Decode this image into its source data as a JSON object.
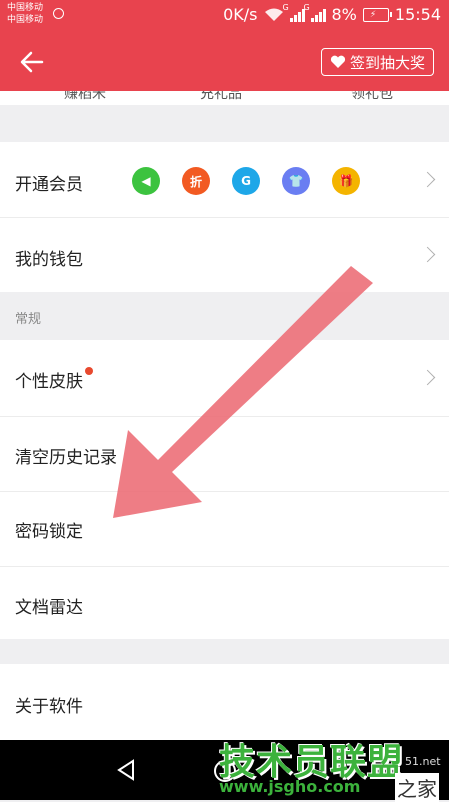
{
  "status_bar": {
    "carrier1": "中国移动",
    "carrier2": "中国移动",
    "speed": "0K/s",
    "network_type": "G",
    "battery": "8%",
    "time": "15:54"
  },
  "app_bar": {
    "signin_label": "签到抽大奖"
  },
  "peek_items": [
    "赚稻米",
    "充礼品",
    "领礼包"
  ],
  "rows": {
    "membership": "开通会员",
    "wallet": "我的钱包",
    "section_general": "常规",
    "skin": "个性皮肤",
    "clear_history": "清空历史记录",
    "password_lock": "密码锁定",
    "doc_radar": "文档雷达",
    "about": "关于软件"
  },
  "vip_icons": [
    {
      "icon": "megaphone-icon",
      "color": "#3cc33f",
      "glyph": "◀"
    },
    {
      "icon": "discount-icon",
      "color": "#f25a22",
      "glyph": "折"
    },
    {
      "icon": "g-icon",
      "color": "#1ea7e8",
      "glyph": "G"
    },
    {
      "icon": "shirt-icon",
      "color": "#6a7ef2",
      "glyph": "👕"
    },
    {
      "icon": "gift-icon",
      "color": "#f4b400",
      "glyph": "🎁"
    }
  ],
  "watermark": {
    "main": "技术员联盟",
    "url": "www.jsgho.com",
    "side": "51.net",
    "zhijia": "之家"
  },
  "colors": {
    "brand": "#e8434e",
    "arrow": "#ec6f78"
  }
}
